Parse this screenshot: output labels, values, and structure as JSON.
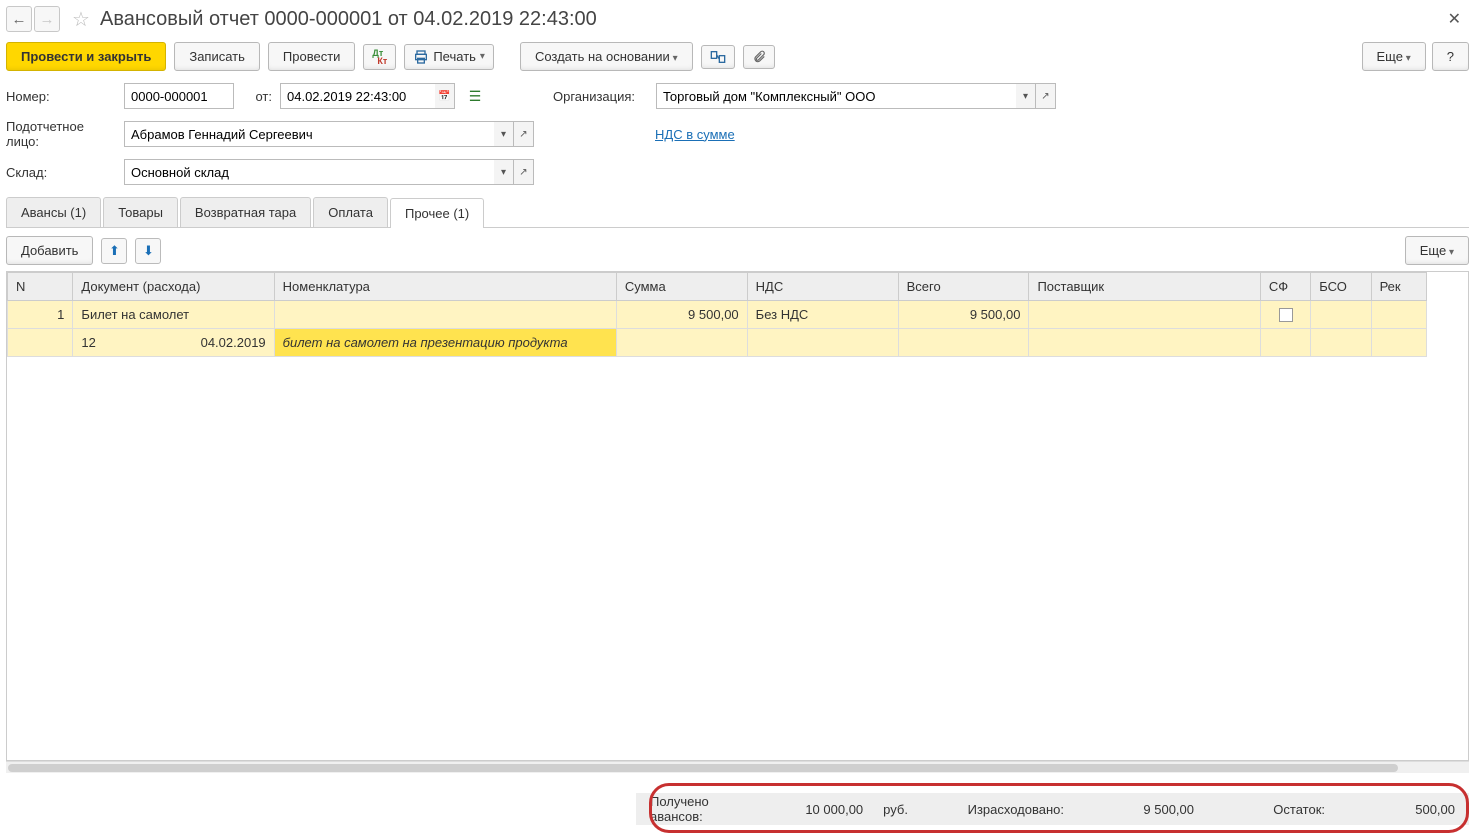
{
  "header": {
    "title": "Авансовый отчет 0000-000001 от 04.02.2019 22:43:00"
  },
  "toolbar": {
    "post_close": "Провести и закрыть",
    "save": "Записать",
    "post": "Провести",
    "print": "Печать",
    "create_based": "Создать на основании",
    "more": "Еще",
    "help": "?"
  },
  "fields": {
    "number_label": "Номер:",
    "number": "0000-000001",
    "from_label": "от:",
    "date": "04.02.2019 22:43:00",
    "org_label": "Организация:",
    "org": "Торговый дом \"Комплексный\" ООО",
    "person_label": "Подотчетное лицо:",
    "person": "Абрамов Геннадий Сергеевич",
    "vat_link": "НДС в сумме",
    "warehouse_label": "Склад:",
    "warehouse": "Основной склад"
  },
  "tabs": {
    "advances": "Авансы (1)",
    "goods": "Товары",
    "returns": "Возвратная тара",
    "payment": "Оплата",
    "other": "Прочее (1)"
  },
  "tbl_toolbar": {
    "add": "Добавить",
    "more": "Еще"
  },
  "columns": {
    "n": "N",
    "doc": "Документ (расхода)",
    "nomen": "Номенклатура",
    "sum": "Сумма",
    "vat": "НДС",
    "total": "Всего",
    "supplier": "Поставщик",
    "sf": "СФ",
    "bso": "БСО",
    "rek": "Рек"
  },
  "row": {
    "n": "1",
    "doc": "Билет на самолет",
    "sum": "9 500,00",
    "vat": "Без НДС",
    "total": "9 500,00",
    "sub_num": "12",
    "sub_date": "04.02.2019",
    "sub_nomen": "билет на самолет на презентацию продукта"
  },
  "footer": {
    "received_lbl": "Получено авансов:",
    "received_val": "10 000,00",
    "currency": "руб.",
    "spent_lbl": "Израсходовано:",
    "spent_val": "9 500,00",
    "balance_lbl": "Остаток:",
    "balance_val": "500,00"
  }
}
